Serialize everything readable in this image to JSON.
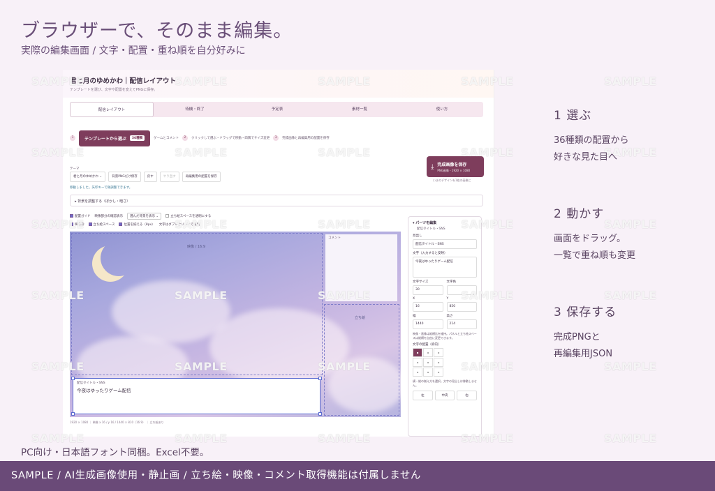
{
  "hero": {
    "title": "ブラウザーで、そのまま編集。",
    "subtitle": "実際の編集画面 / 文字・配置・重ね順を自分好みに"
  },
  "app": {
    "title": "君と月のゆめかわ｜配信レイアウト",
    "description": "テンプレートを選び、文字や配置を変えてPNGに保存。",
    "tabs": [
      "配信レイアウト",
      "待機・終了",
      "予定表",
      "素材一覧",
      "使い方"
    ],
    "active_tab": 0,
    "steps": {
      "s1": "1",
      "template_button": "テンプレートから選ぶ",
      "template_badge": "36種類",
      "game_comment": "ゲームとコメント",
      "s2": "2",
      "s2_text": "クリックして選ぶ・ドラッグで移動・四隅でサイズ変更",
      "s3": "3",
      "s3_text": "完成画像と再編集用の配置を保存"
    },
    "save": {
      "icon": "download-icon",
      "label": "完成画像を保存",
      "spec": "PNG画像・1920 × 1080",
      "note": "いまのデザインを1枚の画像に"
    },
    "theme_label": "テーマ",
    "theme_value": "君と月のゆめかわ",
    "toolbar": {
      "bg_png": "背景PNGだけ保存",
      "undo": "戻す",
      "redo": "やり直す",
      "save_layout": "再編集用の配置を保存"
    },
    "move_note": "移動しました。矢印キーで微調整できます。",
    "bg_adjust": "▸ 背景を調整する（ぼかし・暗さ）",
    "options1": {
      "guide": "配置ガイド",
      "video_check": "映像部分の確認表示",
      "bg_select": "選んだ背景を表示",
      "transparent": "立ち絵スペースを透明にする"
    },
    "options2": {
      "video_frame": "映像枠",
      "standing_space": "立ち絵スペース",
      "snap": "位置を揃える（8px）",
      "dblclick": "文字はダブルクリックで編集"
    },
    "canvas": {
      "video_label": "映像 / 16:9",
      "comment_label": "コメント",
      "standing_label": "立ち絵",
      "title_label": "配信タイトル・SNS",
      "title_text": "今夜はゆったりゲーム配信"
    },
    "status": "1920 × 1080 ｜ 映像 x 16 / y 16 / 1440 × 810（16:9） ｜ 立ち絵あり",
    "panel": {
      "header": "▾ パーツを編集",
      "sub": "配信タイトル・SNS",
      "heading_label": "見出し",
      "heading_value": "配信タイトル・SNS",
      "text_label": "文字（入力すると反映）",
      "text_value": "今夜はゆったりゲーム配信",
      "font_size_label": "文字サイズ",
      "font_size_value": "30",
      "color_label": "文字色",
      "x_label": "X",
      "x_value": "16",
      "y_label": "Y",
      "y_value": "850",
      "w_label": "幅",
      "w_value": "1440",
      "h_label": "高さ",
      "h_value": "214",
      "note": "映像・画像は縦横比を維持。パネルと立ち絵スペースは縦横を自由に変更できます。",
      "align_label": "文字の配置（枠内）",
      "align_note": "横・縦の揃え方を選択。文字の見出しは移動しません。",
      "btn_left": "左",
      "btn_center": "中央",
      "btn_right": "右"
    }
  },
  "watermark": "SAMPLE",
  "features": [
    {
      "title": "1 選ぶ",
      "desc1": "36種類の配置から",
      "desc2": "好きな見た目へ"
    },
    {
      "title": "2 動かす",
      "desc1": "画面をドラッグ。",
      "desc2": "一覧で重ね順も変更"
    },
    {
      "title": "3 保存する",
      "desc1": "完成PNGと",
      "desc2": "再編集用JSON"
    }
  ],
  "note_pc": "PC向け・日本語フォント同梱。Excel不要。",
  "footer": "SAMPLE / AI生成画像使用・静止画 / 立ち絵・映像・コメント取得機能は付属しません",
  "colors": {
    "accent": "#7e3d5c",
    "footer_bg": "#6a4a78",
    "background": "#f8f1f8"
  }
}
